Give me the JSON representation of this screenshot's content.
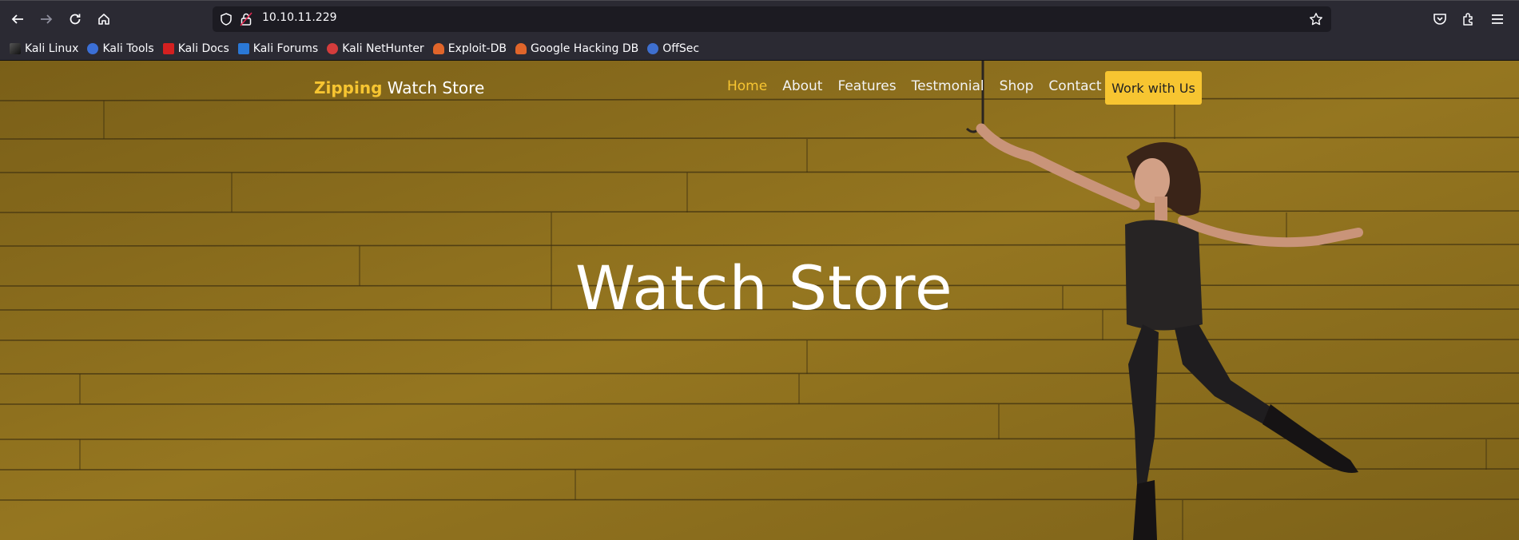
{
  "browser": {
    "url": "10.10.11.229",
    "bookmarks": [
      {
        "label": "Kali Linux",
        "icon": "kali-dragon-icon",
        "color": "#111111"
      },
      {
        "label": "Kali Tools",
        "icon": "kali-tools-icon",
        "color": "#3b6fd6"
      },
      {
        "label": "Kali Docs",
        "icon": "kali-docs-icon",
        "color": "#d42020"
      },
      {
        "label": "Kali Forums",
        "icon": "kali-forums-icon",
        "color": "#2a78d6"
      },
      {
        "label": "Kali NetHunter",
        "icon": "kali-nethunter-icon",
        "color": "#d43c3c"
      },
      {
        "label": "Exploit-DB",
        "icon": "exploit-db-icon",
        "color": "#e0652a"
      },
      {
        "label": "Google Hacking DB",
        "icon": "ghdb-icon",
        "color": "#e0652a"
      },
      {
        "label": "OffSec",
        "icon": "offsec-icon",
        "color": "#3e6fcf"
      }
    ]
  },
  "site": {
    "brand_accent": "Zipping",
    "brand_rest": " Watch Store",
    "nav": [
      {
        "label": "Home",
        "active": true
      },
      {
        "label": "About"
      },
      {
        "label": "Features"
      },
      {
        "label": "Testmonial"
      },
      {
        "label": "Shop"
      },
      {
        "label": "Contact"
      }
    ],
    "cta_label": "Work with Us",
    "hero_title": "Watch Store",
    "colors": {
      "accent": "#f7c531",
      "background": "#8a6d1c"
    }
  }
}
